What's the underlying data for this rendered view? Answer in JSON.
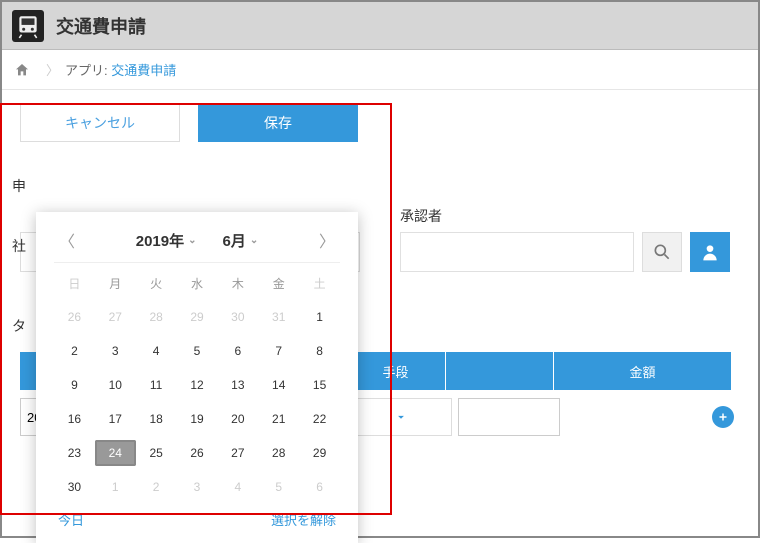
{
  "header": {
    "title": "交通費申請"
  },
  "breadcrumb": {
    "label": "アプリ:",
    "app_link": "交通費申請"
  },
  "buttons": {
    "cancel": "キャンセル",
    "save": "保存"
  },
  "labels": {
    "applicant": "申",
    "company": "社",
    "approver": "承認者",
    "type": "タ"
  },
  "table": {
    "headers": [
      "",
      "",
      "",
      "手段",
      "",
      "金額"
    ],
    "row": {
      "date": "2019-06-24",
      "dash": "------"
    }
  },
  "datepicker": {
    "year": "2019年",
    "month": "6月",
    "dow": [
      "日",
      "月",
      "火",
      "水",
      "木",
      "金",
      "土"
    ],
    "days": [
      {
        "n": 26,
        "o": true
      },
      {
        "n": 27,
        "o": true
      },
      {
        "n": 28,
        "o": true
      },
      {
        "n": 29,
        "o": true
      },
      {
        "n": 30,
        "o": true
      },
      {
        "n": 31,
        "o": true
      },
      {
        "n": 1
      },
      {
        "n": 2
      },
      {
        "n": 3
      },
      {
        "n": 4
      },
      {
        "n": 5
      },
      {
        "n": 6
      },
      {
        "n": 7
      },
      {
        "n": 8
      },
      {
        "n": 9
      },
      {
        "n": 10
      },
      {
        "n": 11
      },
      {
        "n": 12
      },
      {
        "n": 13
      },
      {
        "n": 14
      },
      {
        "n": 15
      },
      {
        "n": 16
      },
      {
        "n": 17
      },
      {
        "n": 18
      },
      {
        "n": 19
      },
      {
        "n": 20
      },
      {
        "n": 21
      },
      {
        "n": 22
      },
      {
        "n": 23
      },
      {
        "n": 24,
        "sel": true
      },
      {
        "n": 25
      },
      {
        "n": 26
      },
      {
        "n": 27
      },
      {
        "n": 28
      },
      {
        "n": 29
      },
      {
        "n": 30
      },
      {
        "n": 1,
        "o": true
      },
      {
        "n": 2,
        "o": true
      },
      {
        "n": 3,
        "o": true
      },
      {
        "n": 4,
        "o": true
      },
      {
        "n": 5,
        "o": true
      },
      {
        "n": 6,
        "o": true
      }
    ],
    "today": "今日",
    "clear": "選択を解除"
  }
}
